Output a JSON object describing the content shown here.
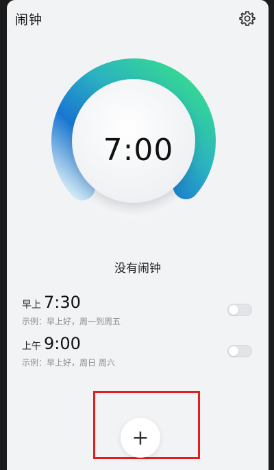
{
  "app": {
    "title": "闹钟"
  },
  "icons": {
    "settings": "gear-icon",
    "add": "plus-icon"
  },
  "dial": {
    "time": "7:00",
    "arc_fraction": 0.73,
    "colors": {
      "arc_start": "#1976d2",
      "arc_mid": "#2bb3c0",
      "arc_end": "#37e08a"
    }
  },
  "status": {
    "no_alarm": "没有闹钟"
  },
  "alarms": [
    {
      "period": "早上",
      "time": "7:30",
      "description": "示例：早上好，周一到周五",
      "enabled": false
    },
    {
      "period": "上午",
      "time": "9:00",
      "description": "示例：早上好，周日 周六",
      "enabled": false
    }
  ],
  "add_button": {
    "label": "+"
  },
  "highlight": {
    "color": "#e41e1e"
  }
}
